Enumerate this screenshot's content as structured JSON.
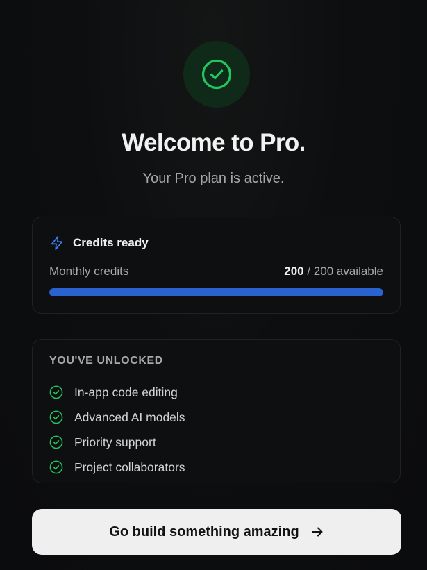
{
  "hero": {
    "icon": "check-circle-icon",
    "accent_color": "#22c55e",
    "title": "Welcome to Pro.",
    "subtitle": "Your Pro plan is active."
  },
  "credits": {
    "icon": "lightning-bolt-icon",
    "icon_color": "#3b82f6",
    "title": "Credits ready",
    "label": "Monthly credits",
    "current": "200",
    "suffix": "/ 200 available",
    "fill_fraction": 1.0,
    "bar_color": "#2a63cf"
  },
  "unlocked": {
    "heading": "YOU'VE UNLOCKED",
    "check_icon": "check-circle-icon",
    "features": [
      "In-app code editing",
      "Advanced AI models",
      "Priority support",
      "Project collaborators"
    ]
  },
  "cta": {
    "label": "Go build something amazing",
    "icon": "arrow-right-icon"
  }
}
